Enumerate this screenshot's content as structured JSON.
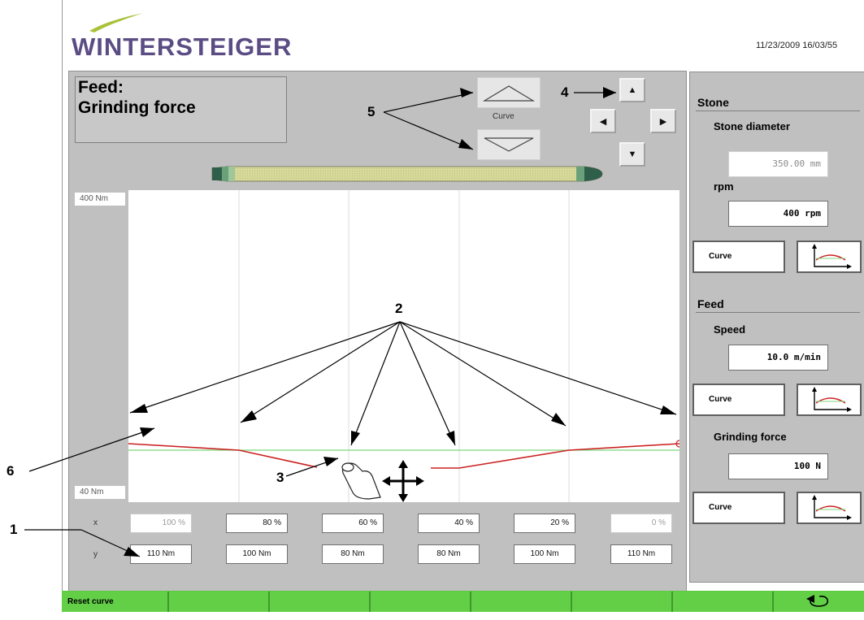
{
  "header": {
    "logo": "WINTERSTEIGER",
    "datetime": "11/23/2009 16/03/55"
  },
  "title": {
    "line1": "Feed:",
    "line2": "Grinding force"
  },
  "curve_control": {
    "label": "Curve"
  },
  "graph": {
    "y_max_label": "400  Nm",
    "y_min_label": "40  Nm",
    "line_color": "#cc2222",
    "reference_color": "#7cd67c"
  },
  "table": {
    "x_label": "x",
    "y_label": "y",
    "x_values": [
      "100  %",
      "80  %",
      "60  %",
      "40  %",
      "20  %",
      "0  %"
    ],
    "y_values": [
      "110   Nm",
      "100   Nm",
      "80   Nm",
      "80   Nm",
      "100   Nm",
      "110   Nm"
    ]
  },
  "sidebar": {
    "stone": {
      "title": "Stone",
      "diameter_label": "Stone diameter",
      "diameter_value": "350.00  mm",
      "rpm_label": "rpm",
      "rpm_value": "400  rpm",
      "curve_button": "Curve"
    },
    "feed": {
      "title": "Feed",
      "speed_label": "Speed",
      "speed_value": "10.0  m/min",
      "speed_curve_button": "Curve",
      "force_label": "Grinding force",
      "force_value": "100  N",
      "force_curve_button": "Curve"
    }
  },
  "bottom_bar": {
    "reset_label": "Reset curve"
  },
  "callouts": {
    "c1": "1",
    "c2": "2",
    "c3": "3",
    "c4": "4",
    "c5": "5",
    "c6": "6"
  },
  "colors": {
    "accent_green": "#62cf47",
    "panel_gray": "#c0c0c0",
    "logo_purple": "#5b4d84"
  }
}
